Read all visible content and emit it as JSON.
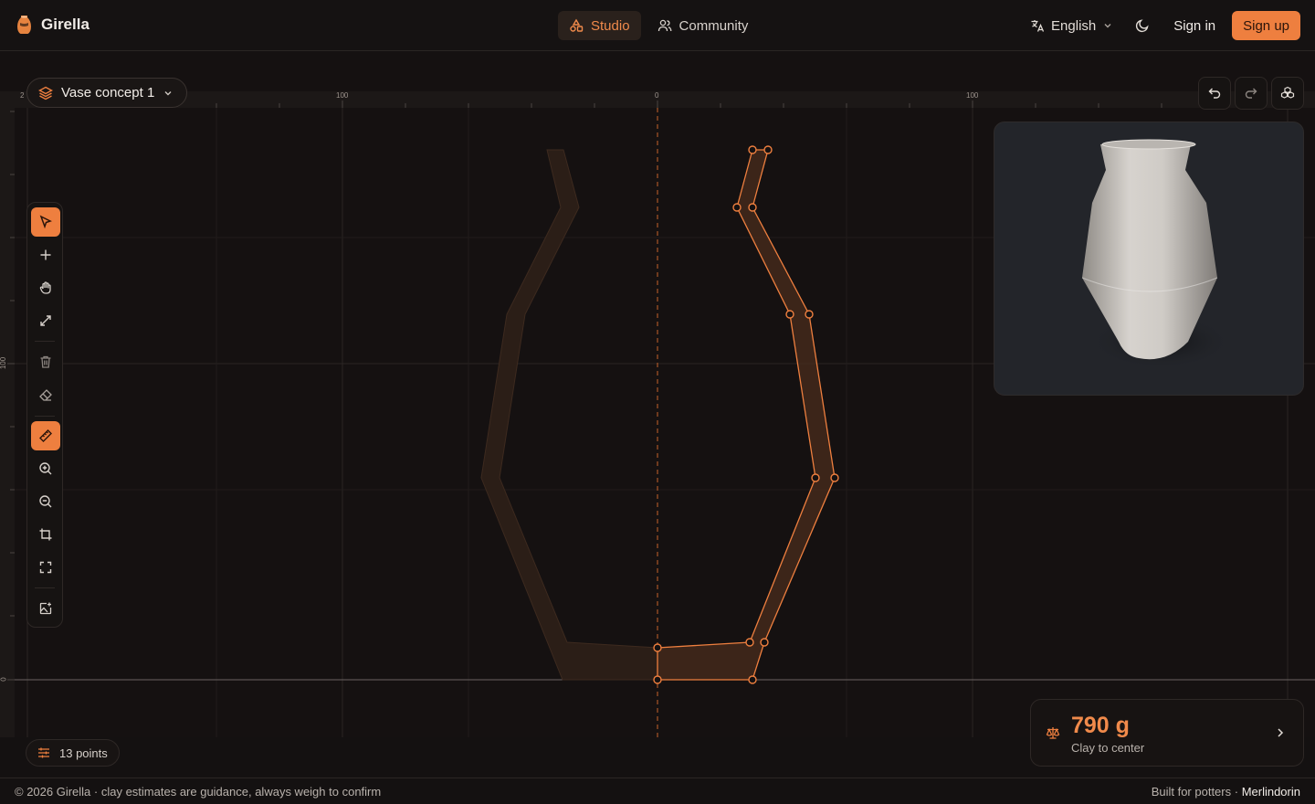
{
  "app": {
    "name": "Girella"
  },
  "nav": {
    "tabs": [
      {
        "label": "Studio",
        "active": true
      },
      {
        "label": "Community",
        "active": false
      }
    ]
  },
  "header": {
    "language": "English",
    "sign_in": "Sign in",
    "sign_up": "Sign up"
  },
  "design": {
    "name": "Vase concept 1"
  },
  "rulers": {
    "top_labels": [
      "100",
      "0",
      "100"
    ],
    "left_labels": [
      "100",
      "0"
    ],
    "left_edge_partial_top": "2",
    "left_edge_partial_side": "2"
  },
  "tools": [
    {
      "name": "select-tool",
      "icon": "cursor-icon",
      "active": true
    },
    {
      "name": "add-point-tool",
      "icon": "plus-icon",
      "active": false
    },
    {
      "name": "pan-tool",
      "icon": "hand-icon",
      "active": false
    },
    {
      "name": "scale-tool",
      "icon": "expand-icon",
      "active": false
    },
    {
      "name": "delete-tool",
      "icon": "trash-icon",
      "active": false
    },
    {
      "name": "eraser-tool",
      "icon": "eraser-icon",
      "active": false
    },
    {
      "name": "ruler-tool",
      "icon": "ruler-icon",
      "active": true
    },
    {
      "name": "zoom-in-tool",
      "icon": "zoom-in-icon",
      "active": false
    },
    {
      "name": "zoom-out-tool",
      "icon": "zoom-out-icon",
      "active": false
    },
    {
      "name": "crop-tool",
      "icon": "crop-icon",
      "active": false
    },
    {
      "name": "fit-view-tool",
      "icon": "fullscreen-icon",
      "active": false
    },
    {
      "name": "image-import-tool",
      "icon": "image-plus-icon",
      "active": false
    }
  ],
  "status": {
    "points": "13 points"
  },
  "clay": {
    "weight": "790 g",
    "label": "Clay to center"
  },
  "footer": {
    "left": "© 2026 Girella · clay estimates are guidance, always weigh to confirm",
    "built_for": "Built for potters ·",
    "author": "Merlindorin"
  },
  "colors": {
    "accent": "#ee7f3f",
    "background": "#141111"
  }
}
